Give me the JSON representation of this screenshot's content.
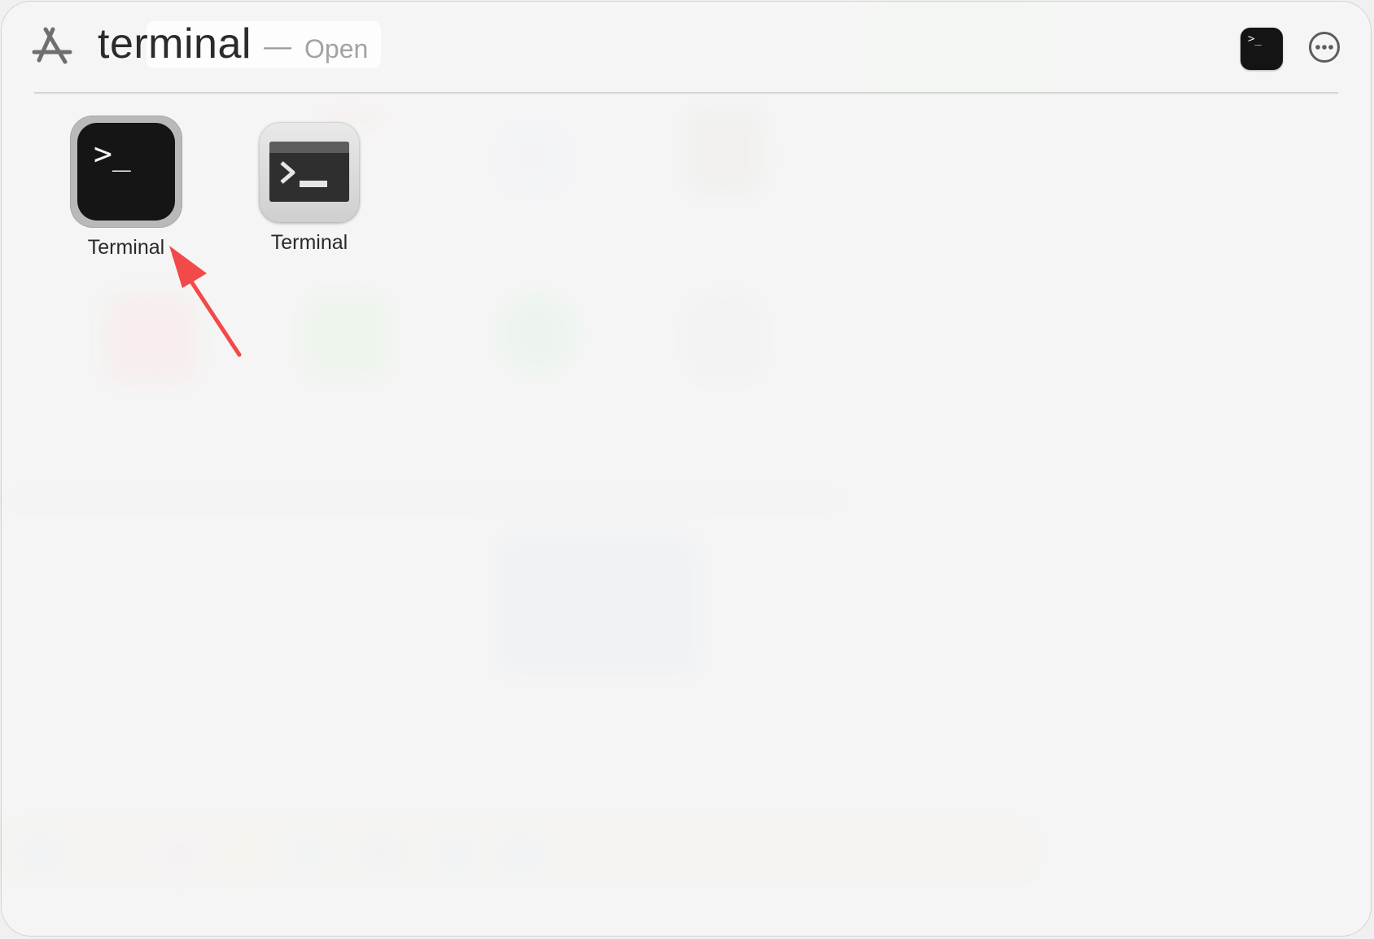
{
  "search": {
    "query": "terminal",
    "separator": "—",
    "action_hint": "Open",
    "source_icon": "app-store-icon"
  },
  "header": {
    "preview_icon": "terminal-preview-icon",
    "preview_glyph": ">_",
    "more_icon": "ellipsis-circle-icon"
  },
  "results": [
    {
      "label": "Terminal",
      "icon": "terminal-app-icon",
      "selected": true
    },
    {
      "label": "Terminal",
      "icon": "terminal-alt-app-icon",
      "selected": false
    }
  ],
  "colors": {
    "annotation_arrow": "#f24949",
    "selection_ring": "#b5b5b5"
  }
}
